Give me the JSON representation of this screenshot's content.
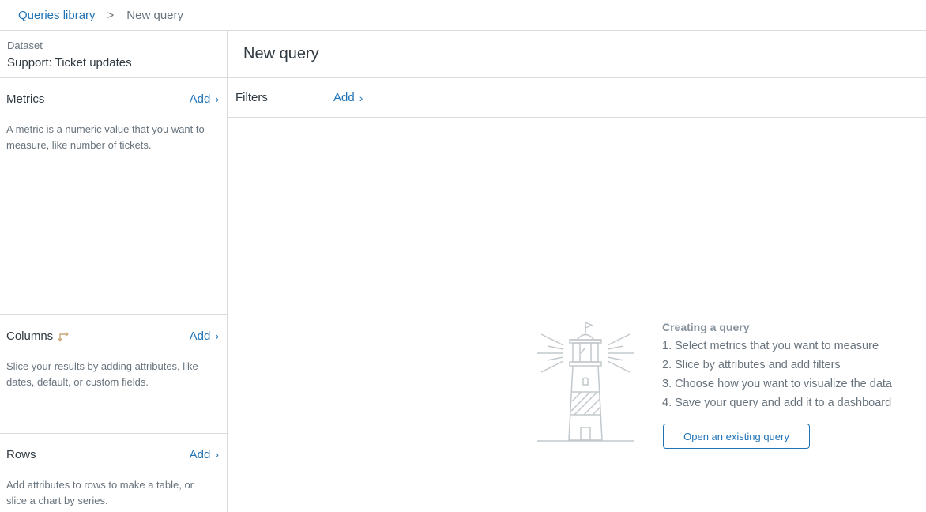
{
  "breadcrumb": {
    "library_label": "Queries library",
    "separator": ">",
    "current_label": "New query"
  },
  "dataset": {
    "label": "Dataset",
    "value": "Support: Ticket updates"
  },
  "sections": {
    "metrics": {
      "title": "Metrics",
      "add_label": "Add",
      "description": "A metric is a numeric value that you want to measure, like number of tickets."
    },
    "columns": {
      "title": "Columns",
      "add_label": "Add",
      "description": "Slice your results by adding attributes, like dates, default, or custom fields."
    },
    "rows": {
      "title": "Rows",
      "add_label": "Add",
      "description": "Add attributes to rows to make a table, or slice a chart by series."
    }
  },
  "main": {
    "title": "New query",
    "filters_label": "Filters",
    "filters_add_label": "Add"
  },
  "empty_state": {
    "heading": "Creating a query",
    "steps": [
      "1. Select metrics that you want to measure",
      "2. Slice by attributes and add filters",
      "3. Choose how you want to visualize the data",
      "4. Save your query and add it to a dashboard"
    ],
    "button_label": "Open an existing query"
  },
  "icons": {
    "chevron": "chevron-right-icon",
    "swap": "swap-axes-icon",
    "illustration": "lighthouse-icon"
  },
  "colors": {
    "link": "#1f73b7",
    "border": "#d8dcde",
    "text": "#2f3941",
    "muted": "#68737d",
    "illustration": "#c2c8cc",
    "swap_icon": "#c9a97a"
  }
}
